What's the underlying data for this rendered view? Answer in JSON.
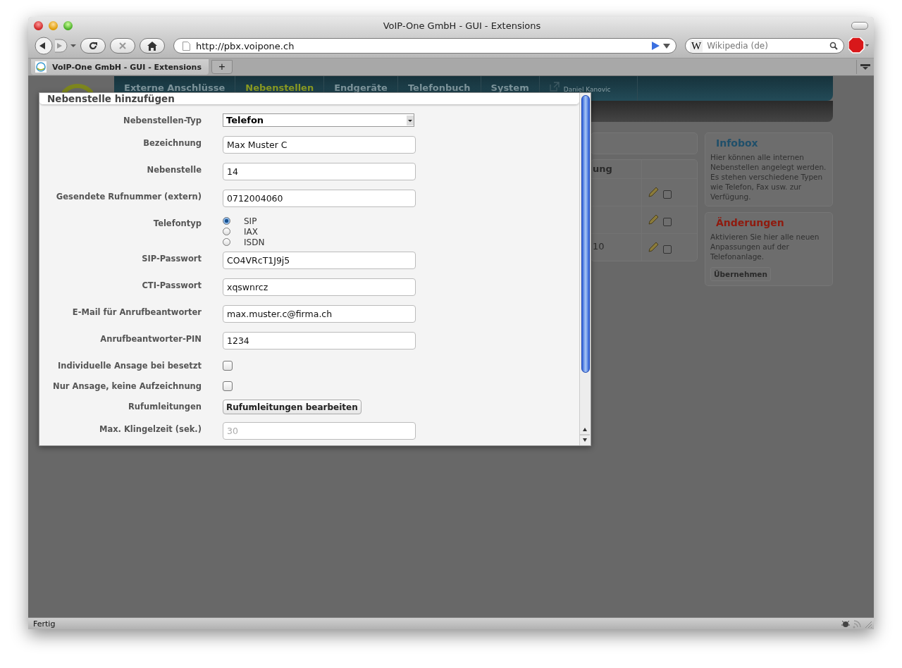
{
  "window": {
    "title": "VoIP-One GmbH - GUI - Extensions"
  },
  "toolbar": {
    "url": "http://pbx.voipone.ch",
    "search_engine": "W",
    "search_placeholder": "Wikipedia (de)"
  },
  "tabs": [
    {
      "label": "VoIP-One GmbH - GUI - Extensions",
      "selected": true
    }
  ],
  "new_tab": "+",
  "page": {
    "nav": [
      {
        "label": "Externe Anschlüsse",
        "selected": false
      },
      {
        "label": "Nebenstellen",
        "selected": true
      },
      {
        "label": "Endgeräte",
        "selected": false
      },
      {
        "label": "Telefonbuch",
        "selected": false
      },
      {
        "label": "System",
        "selected": false
      }
    ],
    "user": "Daniel Kanovic",
    "table": {
      "column_1": "ung",
      "rows": [
        {
          "checked": false
        },
        {
          "checked": false
        },
        {
          "column_1": "10",
          "checked": false
        }
      ]
    },
    "infobox": {
      "title": "Infobox",
      "text": "Hier können alle internen Nebenstellen angelegt werden. Es stehen verschiedene Typen wie Telefon, Fax usw. zur Verfügung."
    },
    "changes": {
      "title": "Änderungen",
      "text": "Aktivieren Sie hier alle neuen Anpassungen auf der Telefonanlage.",
      "button": "Übernehmen"
    }
  },
  "dialog": {
    "title": "Nebenstelle hinzufügen",
    "fields": [
      {
        "kind": "select",
        "label": "Nebenstellen-Typ",
        "value": "Telefon"
      },
      {
        "kind": "text",
        "label": "Bezeichnung",
        "value": "Max Muster C"
      },
      {
        "kind": "text",
        "label": "Nebenstelle",
        "value": "14"
      },
      {
        "kind": "text",
        "label": "Gesendete Rufnummer (extern)",
        "value": "0712004060"
      },
      {
        "kind": "radio",
        "label": "Telefontyp",
        "options": [
          {
            "label": "SIP",
            "selected": true
          },
          {
            "label": "IAX",
            "selected": false
          },
          {
            "label": "ISDN",
            "selected": false
          }
        ]
      },
      {
        "kind": "text",
        "label": "SIP-Passwort",
        "value": "CO4VRcT1J9j5"
      },
      {
        "kind": "text",
        "label": "CTI-Passwort",
        "value": "xqswnrcz"
      },
      {
        "kind": "text",
        "label": "E-Mail für Anrufbeantworter",
        "value": "max.muster.c@firma.ch"
      },
      {
        "kind": "text",
        "label": "Anrufbeantworter-PIN",
        "value": "1234"
      },
      {
        "kind": "checkbox",
        "label": "Individuelle Ansage bei besetzt",
        "checked": false
      },
      {
        "kind": "checkbox",
        "label": "Nur Ansage, keine Aufzeichnung",
        "checked": false
      },
      {
        "kind": "button",
        "label": "Rufumleitungen",
        "button": "Rufumleitungen bearbeiten"
      },
      {
        "kind": "text",
        "label": "Max. Klingelzeit (sek.)",
        "placeholder": "30"
      }
    ]
  },
  "status_bar": {
    "text": "Fertig"
  }
}
